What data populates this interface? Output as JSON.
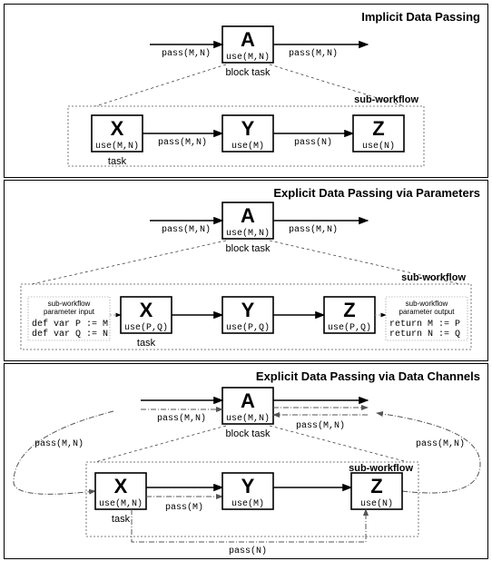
{
  "panels": [
    {
      "title": "Implicit Data Passing"
    },
    {
      "title": "Explicit Data Passing via Parameters"
    },
    {
      "title": "Explicit Data Passing via Data Channels"
    }
  ],
  "labels": {
    "block_task": "block task",
    "sub_workflow": "sub-workflow",
    "task": "task",
    "param_in": "sub-workflow parameter input",
    "param_out": "sub-workflow parameter output",
    "A": "A",
    "X": "X",
    "Y": "Y",
    "Z": "Z",
    "use_MN": "use(M,N)",
    "use_M": "use(M)",
    "use_N": "use(N)",
    "use_PQ": "use(P,Q)",
    "pass_MN": "pass(M,N)",
    "pass_M": "pass(M)",
    "pass_N": "pass(N)",
    "def_P": "def var P := M",
    "def_Q": "def var Q := N",
    "ret_M": "return M := P",
    "ret_N": "return N := Q"
  },
  "chart_data": {
    "type": "diagram",
    "sections": [
      {
        "name": "Implicit Data Passing",
        "top": {
          "task": "A",
          "uses": "use(M,N)",
          "in_edge": "pass(M,N)",
          "out_edge": "pass(M,N)",
          "label": "block task"
        },
        "subworkflow": {
          "label": "sub-workflow",
          "nodes": [
            {
              "id": "X",
              "uses": "use(M,N)",
              "out_edge": "pass(M,N)",
              "label_below": "task"
            },
            {
              "id": "Y",
              "uses": "use(M)",
              "out_edge": "pass(N)"
            },
            {
              "id": "Z",
              "uses": "use(N)"
            }
          ]
        }
      },
      {
        "name": "Explicit Data Passing via Parameters",
        "top": {
          "task": "A",
          "uses": "use(M,N)",
          "in_edge": "pass(M,N)",
          "out_edge": "pass(M,N)",
          "label": "block task"
        },
        "subworkflow": {
          "label": "sub-workflow",
          "param_input": [
            "def var P := M",
            "def var Q := N"
          ],
          "param_output": [
            "return M := P",
            "return N := Q"
          ],
          "nodes": [
            {
              "id": "X",
              "uses": "use(P,Q)",
              "label_below": "task"
            },
            {
              "id": "Y",
              "uses": "use(P,Q)"
            },
            {
              "id": "Z",
              "uses": "use(P,Q)"
            }
          ]
        }
      },
      {
        "name": "Explicit Data Passing via Data Channels",
        "top": {
          "task": "A",
          "uses": "use(M,N)",
          "in_edge": "pass(M,N)",
          "out_edge": "pass(M,N)",
          "label": "block task"
        },
        "subworkflow": {
          "label": "sub-workflow",
          "back_channels": [
            "pass(M,N)",
            "pass(M,N)"
          ],
          "nodes": [
            {
              "id": "X",
              "uses": "use(M,N)",
              "out_edges": [
                "pass(M)",
                "pass(N)"
              ],
              "label_below": "task"
            },
            {
              "id": "Y",
              "uses": "use(M)"
            },
            {
              "id": "Z",
              "uses": "use(N)"
            }
          ]
        }
      }
    ]
  }
}
